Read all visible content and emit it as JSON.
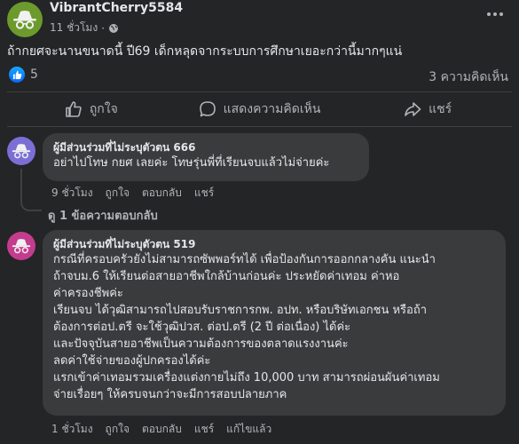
{
  "post": {
    "author": "VibrantCherry5584",
    "time": "11 ชั่วโมง",
    "text": "ถ้ากยศจะนานขนาดนี้ ปี69 เด็กหลุดจากระบบการศึกษาเยอะกว่านี้มากๆแน่",
    "reaction_count": "5",
    "comment_count": "3 ความคิดเห็น"
  },
  "actions": {
    "like": "ถูกใจ",
    "comment": "แสดงความคิดเห็น",
    "share": "แชร์"
  },
  "comments": [
    {
      "author": "ผู้มีส่วนร่วมที่ไม่ระบุตัวตน 666",
      "avatar_color": "#7b6fd6",
      "lines": [
        "อย่าไปโทษ กยศ เลยค่ะ โทษรุ่นพี่ที่เรียนจบแล้วไม่จ่ายค่ะ"
      ],
      "time": "9 ชั่วโมง",
      "like": "ถูกใจ",
      "reply": "ตอบกลับ",
      "share": "แชร์",
      "view_replies": "ดู 1 ข้อความตอบกลับ"
    },
    {
      "author": "ผู้มีส่วนร่วมที่ไม่ระบุตัวตน 519",
      "avatar_color": "#c43c8e",
      "lines": [
        "กรณีที่ครอบครัวยังไม่สามารถซัพพอร์ทได้ เพื่อป้องกันการออกกลางคัน แนะนำ",
        "ถ้าจบม.6 ให้เรียนต่อสายอาชีพใกล้บ้านก่อนค่ะ ประหยัดค่าเทอม ค่าหอ",
        "ค่าครองชีพค่ะ",
        "เรียนจบ ได้วุฒิสามารถไปสอบรับราชการกพ. อปท. หรือบริษัทเอกชน หรือถ้า",
        "ต้องการต่อป.ตรี จะใช้วุฒิปวส. ต่อป.ตรี (2 ปี ต่อเนื่อง) ได้ค่ะ",
        "และปัจจุบันสายอาชีพเป็นความต้องการของตลาดแรงงานค่ะ",
        "ลดค่าใช้จ่ายของผู้ปกครองได้ค่ะ",
        "แรกเข้าค่าเทอมรวมเครื่องแต่งกายไม่ถึง 10,000 บาท สามารถผ่อนผันค่าเทอม",
        "จ่ายเรื่อยๆ ให้ครบจนกว่าจะมีการสอบปลายภาค"
      ],
      "time": "1 ชั่วโมง",
      "like": "ถูกใจ",
      "reply": "ตอบกลับ",
      "share": "แชร์",
      "edited": "แก้ไขแล้ว"
    }
  ],
  "icons": {
    "avatar": "incognito-icon",
    "privacy": "globe-icon",
    "more": "more-dots-icon",
    "reaction": "like-reaction-icon",
    "like": "thumbs-up-icon",
    "comment": "comment-bubble-icon",
    "share": "share-arrow-icon"
  },
  "colors": {
    "background": "#242526",
    "bubble": "#3a3b3c",
    "text_primary": "#e4e6eb",
    "text_secondary": "#b0b3b8",
    "post_avatar": "#6c9a2c",
    "like_blue": "#0866ff"
  }
}
